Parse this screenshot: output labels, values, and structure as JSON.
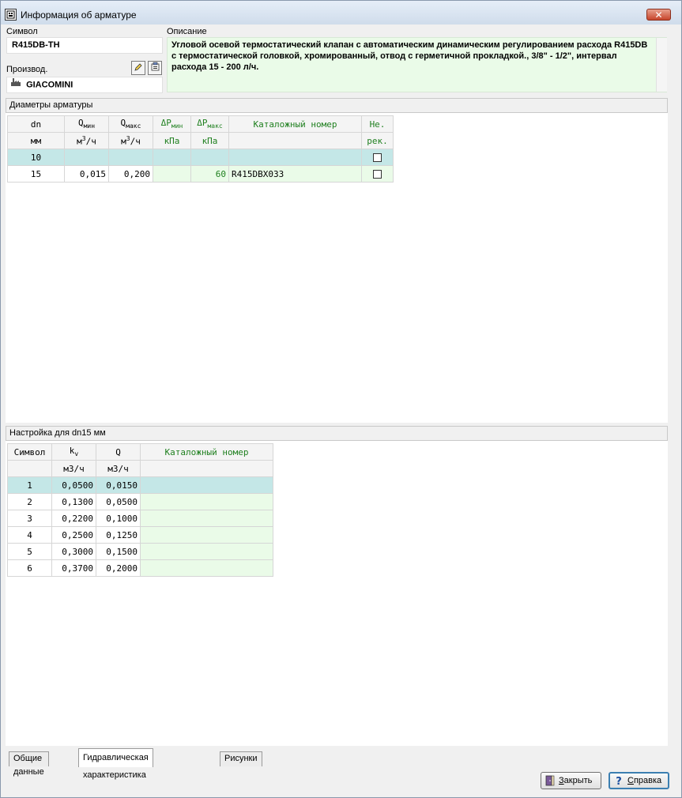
{
  "window": {
    "title": "Информация об арматуре",
    "close_label": "✕"
  },
  "symbol": {
    "label": "Символ",
    "value": "R415DB-TH"
  },
  "manufacturer": {
    "label": "Производ.",
    "value": "GIACOMINI"
  },
  "description": {
    "label": "Описание",
    "text": "Угловой осевой термостатический клапан с автоматическим динамическим регулированием расхода R415DB с термостатической головкой, хромированный, отвод с герметичной прокладкой., 3/8\" - 1/2\", интервал расхода 15 - 200 л/ч."
  },
  "diameters": {
    "section_title": "Диаметры арматуры",
    "headers": {
      "dn": "dn",
      "qmin_main": "Q",
      "qmin_sub": "мин",
      "qmax_main": "Q",
      "qmax_sub": "макс",
      "dpmin_main": "ΔP",
      "dpmin_sub": "мин",
      "dpmax_main": "ΔP",
      "dpmax_sub": "макс",
      "catalog": "Каталожный номер",
      "notrec": "Не."
    },
    "units": {
      "dn": "мм",
      "q_main": "м",
      "q_sup": "3",
      "q_rest": "/ч",
      "dp": "кПа",
      "notrec": "рек."
    },
    "rows": [
      {
        "dn": "10",
        "qmin": "",
        "qmax": "",
        "dpmin": "",
        "dpmax": "",
        "catalog": "",
        "notrec": false
      },
      {
        "dn": "15",
        "qmin": "0,015",
        "qmax": "0,200",
        "dpmin": "",
        "dpmax": "60",
        "catalog": "R415DBX033",
        "notrec": false
      }
    ]
  },
  "settings": {
    "section_title": "Настройка для dn15  мм",
    "headers": {
      "symbol": "Символ",
      "kv_main": "k",
      "kv_sub": "v",
      "q": "Q",
      "catalog": "Каталожный номер"
    },
    "units": {
      "kv": "м3/ч",
      "q": "м3/ч"
    },
    "rows": [
      {
        "symbol": "1",
        "kv": "0,0500",
        "q": "0,0150",
        "catalog": ""
      },
      {
        "symbol": "2",
        "kv": "0,1300",
        "q": "0,0500",
        "catalog": ""
      },
      {
        "symbol": "3",
        "kv": "0,2200",
        "q": "0,1000",
        "catalog": ""
      },
      {
        "symbol": "4",
        "kv": "0,2500",
        "q": "0,1250",
        "catalog": ""
      },
      {
        "symbol": "5",
        "kv": "0,3000",
        "q": "0,1500",
        "catalog": ""
      },
      {
        "symbol": "6",
        "kv": "0,3700",
        "q": "0,2000",
        "catalog": ""
      }
    ]
  },
  "tabs": [
    {
      "label": "Общие данные"
    },
    {
      "label": "Гидравлическая характеристика"
    },
    {
      "label": "Рисунки"
    }
  ],
  "buttons": {
    "close_hotkey": "З",
    "close_rest": "акрыть",
    "help_hotkey": "С",
    "help_rest": "правка"
  },
  "colors": {
    "selected_row": "#c4e7e7",
    "editable_cell": "#eafbe8",
    "header_green": "#208020"
  }
}
